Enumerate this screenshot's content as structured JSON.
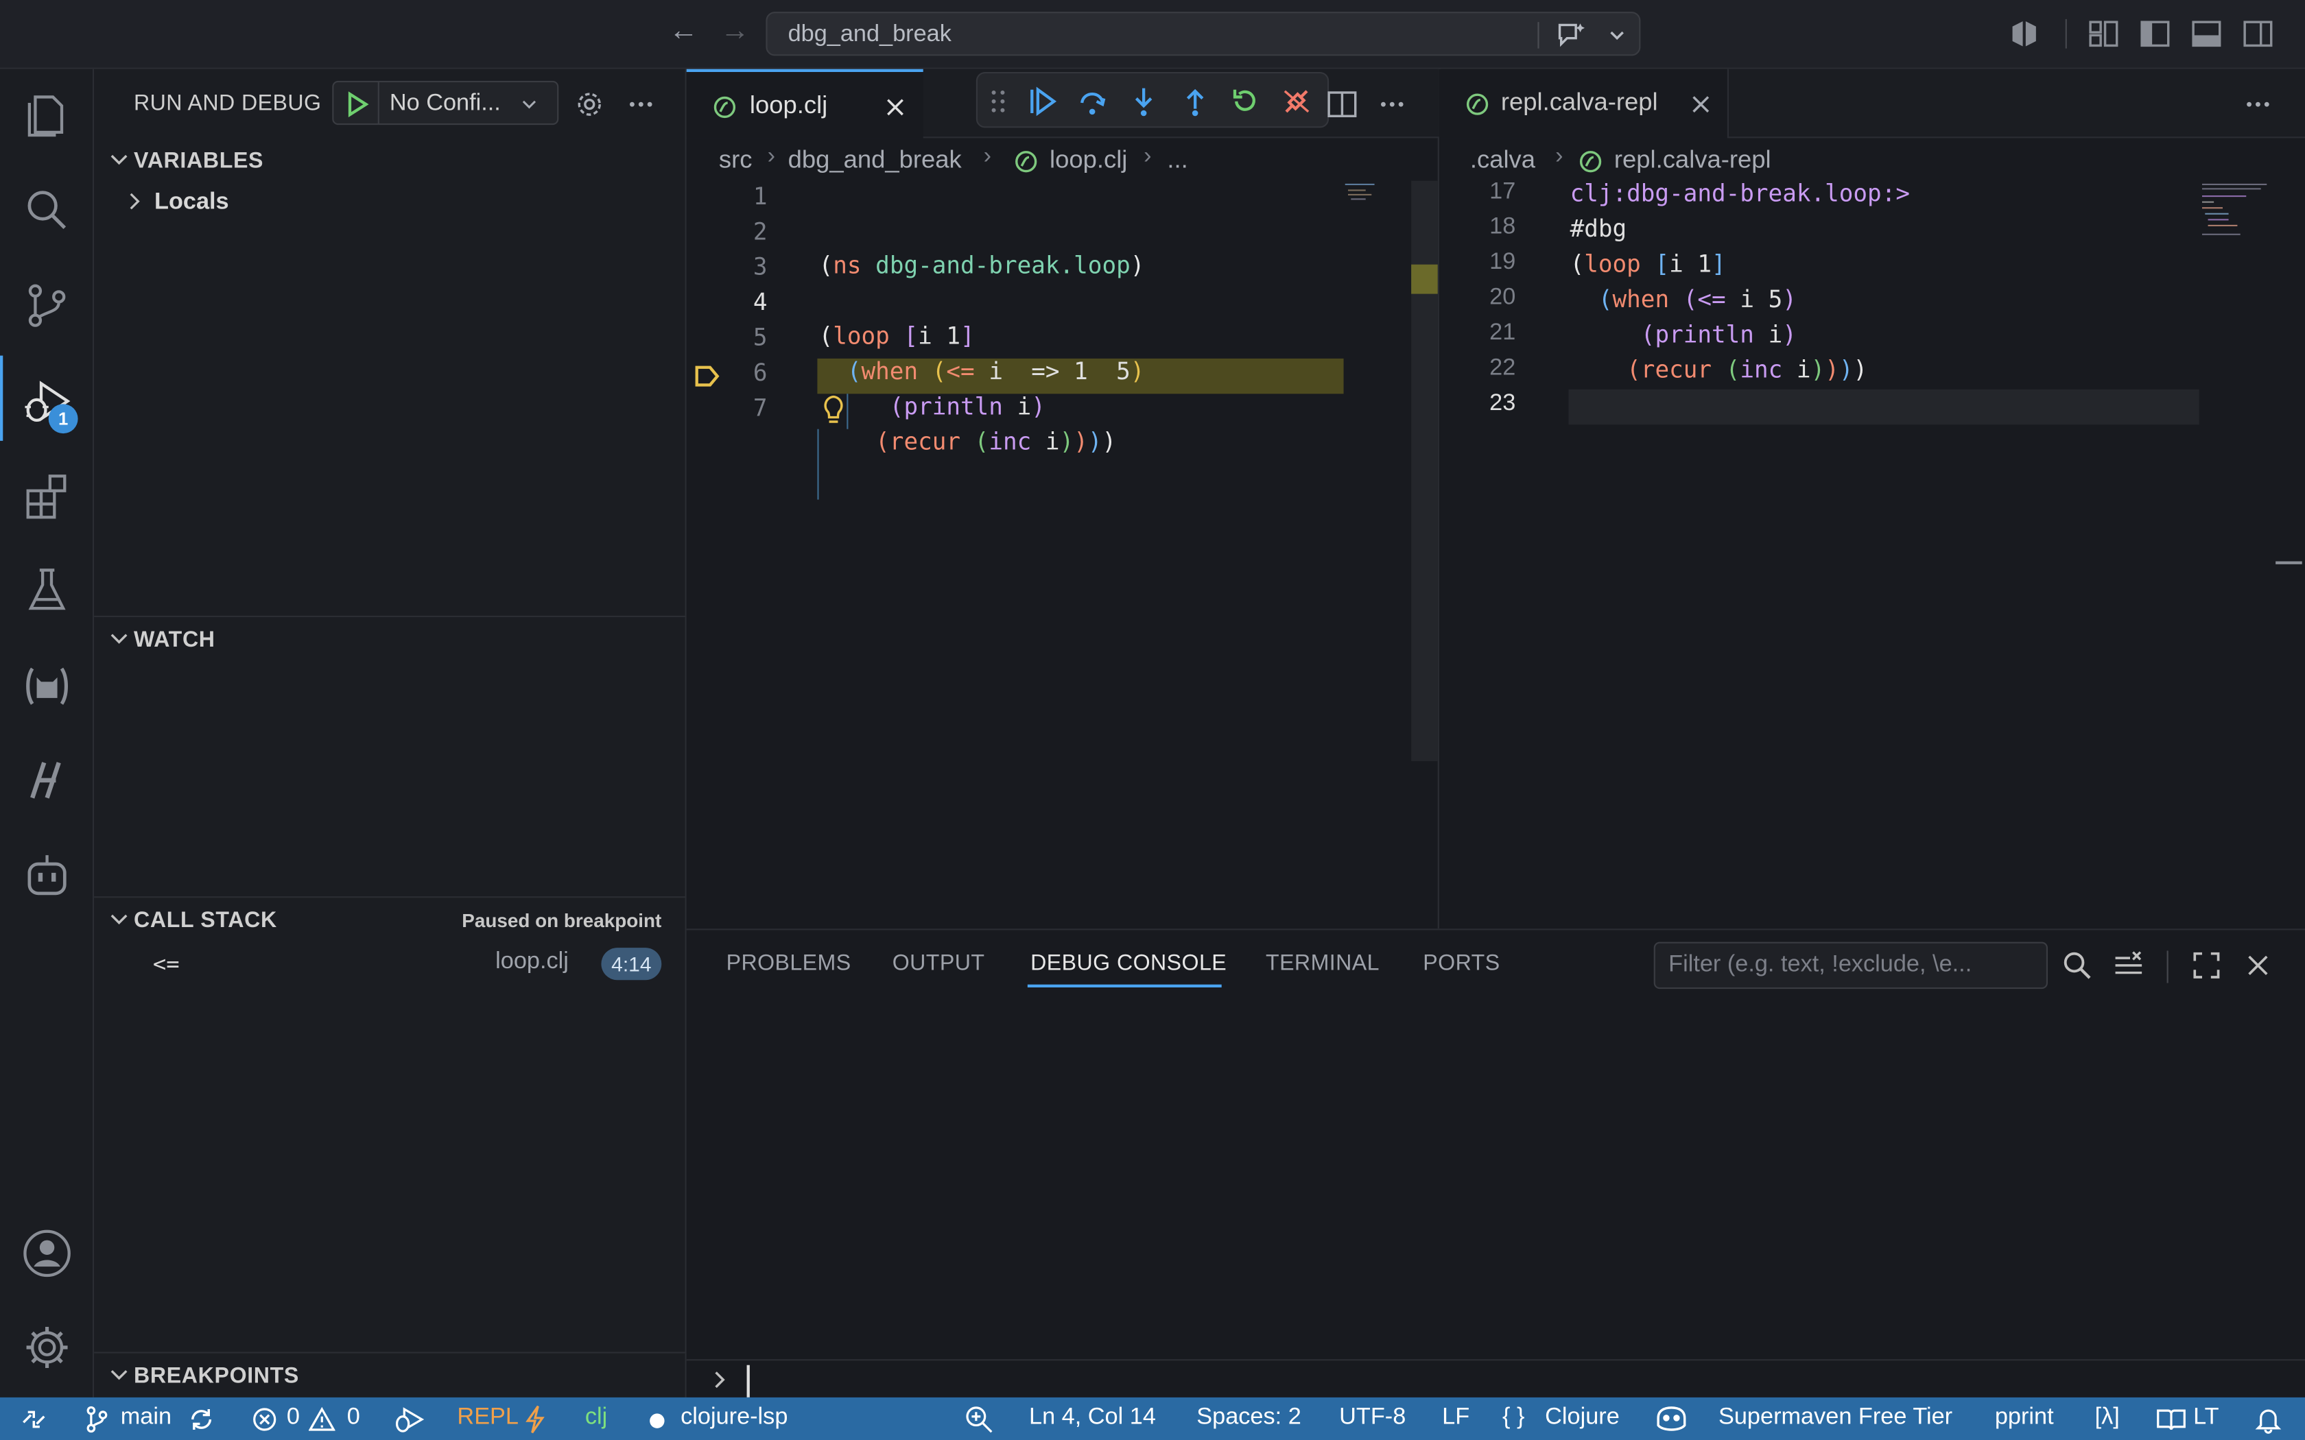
{
  "titlebar": {
    "search_text": "dbg_and_break"
  },
  "activity_badge": "1",
  "sidebar": {
    "title": "RUN AND DEBUG",
    "config_label": "No Confi...",
    "sections": {
      "variables": "VARIABLES",
      "locals": "Locals",
      "watch": "WATCH",
      "call_stack": "CALL STACK",
      "call_stack_status": "Paused on breakpoint",
      "breakpoints": "BREAKPOINTS"
    },
    "stack_frame": {
      "name": "<=",
      "file": "loop.clj",
      "position": "4:14"
    }
  },
  "editor_left": {
    "tab_label": "loop.clj",
    "breadcrumbs": [
      "src",
      "dbg_and_break",
      "loop.clj",
      "..."
    ],
    "line_numbers": [
      "1",
      "2",
      "3",
      "4",
      "5",
      "6",
      "7"
    ],
    "inline_value": "=> 1"
  },
  "editor_right": {
    "tab_label": "repl.calva-repl",
    "breadcrumbs": [
      ".calva",
      "repl.calva-repl"
    ],
    "line_numbers": [
      "17",
      "18",
      "19",
      "20",
      "21",
      "22",
      "23"
    ],
    "prompt": "clj:dbg-and-break.loop:>",
    "tag": "#dbg"
  },
  "panel": {
    "tabs": [
      "PROBLEMS",
      "OUTPUT",
      "DEBUG CONSOLE",
      "TERMINAL",
      "PORTS"
    ],
    "active_tab": "DEBUG CONSOLE",
    "filter_placeholder": "Filter (e.g. text, !exclude, \\e..."
  },
  "statusbar": {
    "branch": "main",
    "errors": "0",
    "warnings": "0",
    "repl": "REPL",
    "clj": "clj",
    "lsp": "clojure-lsp",
    "position": "Ln 4, Col 14",
    "spaces": "Spaces: 2",
    "encoding": "UTF-8",
    "eol": "LF",
    "language": "Clojure",
    "supermaven": "Supermaven Free Tier",
    "pprint": "pprint",
    "lambda": "[λ]",
    "lt": "LT"
  },
  "colors": {
    "accent": "#4aa3f0",
    "statusbar": "#2a6aa3",
    "breakpoint_line": "#4d4a1f",
    "breakpoint_marker": "#e8c24d"
  }
}
